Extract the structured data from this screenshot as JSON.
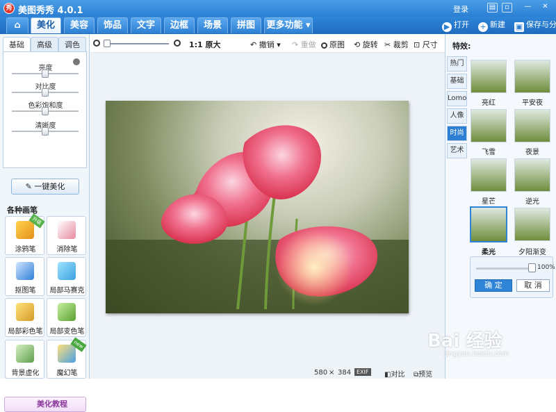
{
  "app": {
    "title": "美图秀秀 4.0.1",
    "logo_text": "秀",
    "login": "登录"
  },
  "window_controls": [
    "msg-icon",
    "restore-icon",
    "minimize-icon",
    "close-icon"
  ],
  "nav": {
    "tabs": [
      "美化",
      "美容",
      "饰品",
      "文字",
      "边框",
      "场景",
      "拼图",
      "更多功能"
    ],
    "active": "美化"
  },
  "top_actions": [
    {
      "icon": "open-icon",
      "label": "打开"
    },
    {
      "icon": "new-icon",
      "label": "新建"
    },
    {
      "icon": "save-icon",
      "label": "保存与分享"
    }
  ],
  "left_panel": {
    "tabs": [
      "基础",
      "高级",
      "调色"
    ],
    "active_tab": "基础",
    "sliders": [
      {
        "label": "亮度",
        "value": 0.5
      },
      {
        "label": "对比度",
        "value": 0.5
      },
      {
        "label": "色彩饱和度",
        "value": 0.5
      },
      {
        "label": "清晰度",
        "value": 0.5
      }
    ],
    "one_key": "一键美化",
    "brushes_title": "各种画笔",
    "brushes": [
      {
        "label": "涂鸦笔",
        "badge": "升级"
      },
      {
        "label": "消除笔",
        "badge": ""
      },
      {
        "label": "抠图笔",
        "badge": ""
      },
      {
        "label": "局部马赛克",
        "badge": ""
      },
      {
        "label": "局部彩色笔",
        "badge": ""
      },
      {
        "label": "局部变色笔",
        "badge": ""
      },
      {
        "label": "背景虚化",
        "badge": ""
      },
      {
        "label": "魔幻笔",
        "badge": "new"
      }
    ],
    "tutorial": "美化教程"
  },
  "toolbar": {
    "zoom_value": 0.0,
    "actual_size": "1:1 原大",
    "undo": "撤销",
    "redo": "重做",
    "original": "原图",
    "rotate": "旋转",
    "crop": "裁剪",
    "resize": "尺寸"
  },
  "status": {
    "width": "580",
    "times": "×",
    "height": "384",
    "exif": "EXIF",
    "compare": "对比",
    "preview": "预览"
  },
  "right_panel": {
    "title": "特效:",
    "tabs": [
      "热门",
      "基础",
      "Lomo",
      "人像",
      "时尚",
      "艺术"
    ],
    "active_tab": "时尚",
    "effects": [
      {
        "label": "亮红",
        "selected": false
      },
      {
        "label": "平安夜",
        "selected": false
      },
      {
        "label": "飞雪",
        "selected": false
      },
      {
        "label": "夜景",
        "selected": false
      },
      {
        "label": "星芒",
        "selected": false
      },
      {
        "label": "逆光",
        "selected": false
      },
      {
        "label": "柔光",
        "selected": true
      },
      {
        "label": "夕阳渐变",
        "selected": false
      }
    ],
    "intensity_pct": "100%",
    "intensity_value": 1.0,
    "ok": "确 定",
    "cancel": "取 消"
  },
  "watermark": {
    "brand": "Bai 经验",
    "url": "jingyan.baidu.com"
  }
}
